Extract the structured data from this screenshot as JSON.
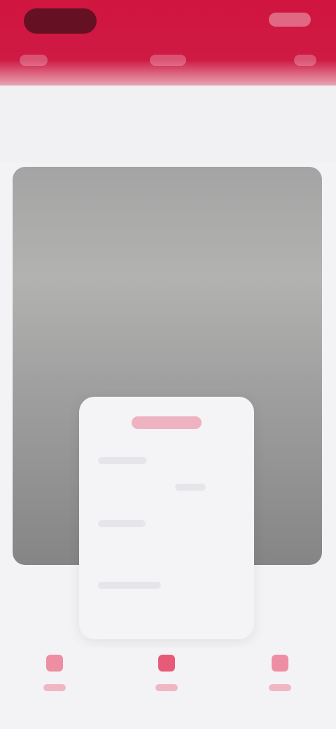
{
  "header": {
    "title": "",
    "tabs": [
      {
        "label": ""
      },
      {
        "label": ""
      },
      {
        "label": ""
      }
    ]
  },
  "popup": {
    "title": "",
    "items": [
      {
        "label": ""
      },
      {
        "label": ""
      },
      {
        "label": ""
      }
    ]
  },
  "bottom_nav": {
    "items": [
      {
        "label": ""
      },
      {
        "label": ""
      },
      {
        "label": ""
      }
    ]
  },
  "colors": {
    "brand": "#d0153f",
    "background": "#f3f3f5"
  }
}
